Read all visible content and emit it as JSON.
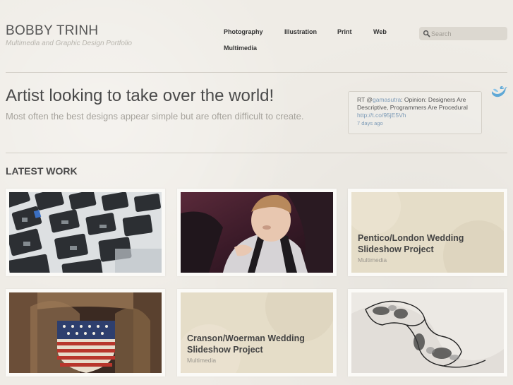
{
  "header": {
    "brand_title": "BOBBY TRINH",
    "brand_subtitle": "Multimedia and Graphic Design Portfolio"
  },
  "nav": {
    "items": [
      "Photography",
      "Illustration",
      "Print",
      "Web",
      "Multimedia"
    ]
  },
  "search": {
    "placeholder": "Search",
    "icon": "search-icon"
  },
  "hero": {
    "title": "Artist looking to take over the world!",
    "subtitle": "Most often the best designs appear simple but are often difficult to create."
  },
  "tweet": {
    "prefix": "RT @",
    "handle": "gamasutra",
    "body": ": Opinion: Designers Are Descriptive, Programmers Are Procedural ",
    "link": "http://t.co/95jE5Vh",
    "time": "7 days ago",
    "icon": "twitter-bird-icon"
  },
  "latest": {
    "heading": "LATEST WORK",
    "items": [
      {
        "kind": "photo",
        "image": "keyboard-photo"
      },
      {
        "kind": "photo",
        "image": "child-in-car-seat-photo"
      },
      {
        "kind": "text",
        "title": "Pentico/London Wedding Slideshow Project",
        "category": "Multimedia"
      },
      {
        "kind": "photo",
        "image": "american-flag-shield-photo"
      },
      {
        "kind": "text",
        "title": "Cranson/Woerman Wedding Slideshow Project",
        "category": "Multimedia"
      },
      {
        "kind": "photo",
        "image": "ink-sketch-illustration"
      }
    ]
  },
  "colors": {
    "background": "#efece6",
    "link": "#7d9bb7",
    "search_bg": "#dcd8d0",
    "card_bg": "#fbfaf7"
  }
}
